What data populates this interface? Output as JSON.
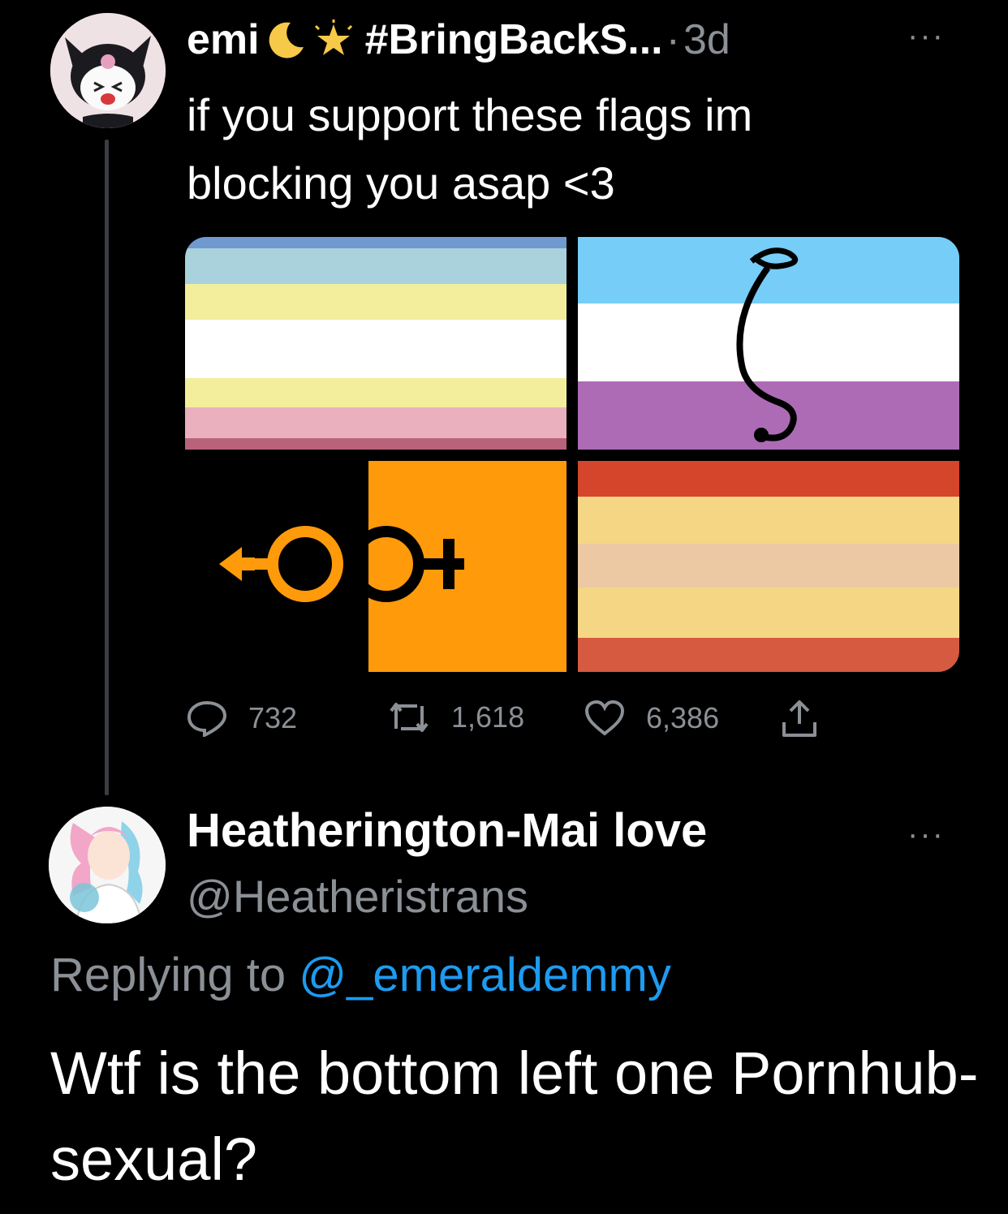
{
  "tweet": {
    "name": "emi",
    "hashtag": "#BringBackS...",
    "dot": "·",
    "time": "3d",
    "text": "if you support these flags im blocking you asap <3",
    "replies": "732",
    "retweets": "1,618",
    "likes": "6,386",
    "more": "···",
    "emojis": [
      "crescent-moon-icon",
      "glowing-star-icon"
    ]
  },
  "flags": {
    "top_left": [
      "#7099cf",
      "#a9d2dd",
      "#f3ee9b",
      "#ffffff",
      "#f3ee9b",
      "#ebb0bd",
      "#b9637a"
    ],
    "top_right": [
      "#76cdf7",
      "#ffffff",
      "#ad6bb5"
    ],
    "bottom_left": [
      "#000000",
      "#ff9a0b"
    ],
    "bottom_right": [
      "#d5452c",
      "#f4d684",
      "#ecc8a3",
      "#f4d684",
      "#d65a3f"
    ]
  },
  "reply": {
    "name": "Heatherington-Mai love",
    "handle": "@Heatheristrans",
    "replying_prefix": "Replying to",
    "replying_to": "@_emeraldemmy",
    "text": "Wtf is the bottom left one Pornhub-sexual?",
    "more": "···"
  }
}
